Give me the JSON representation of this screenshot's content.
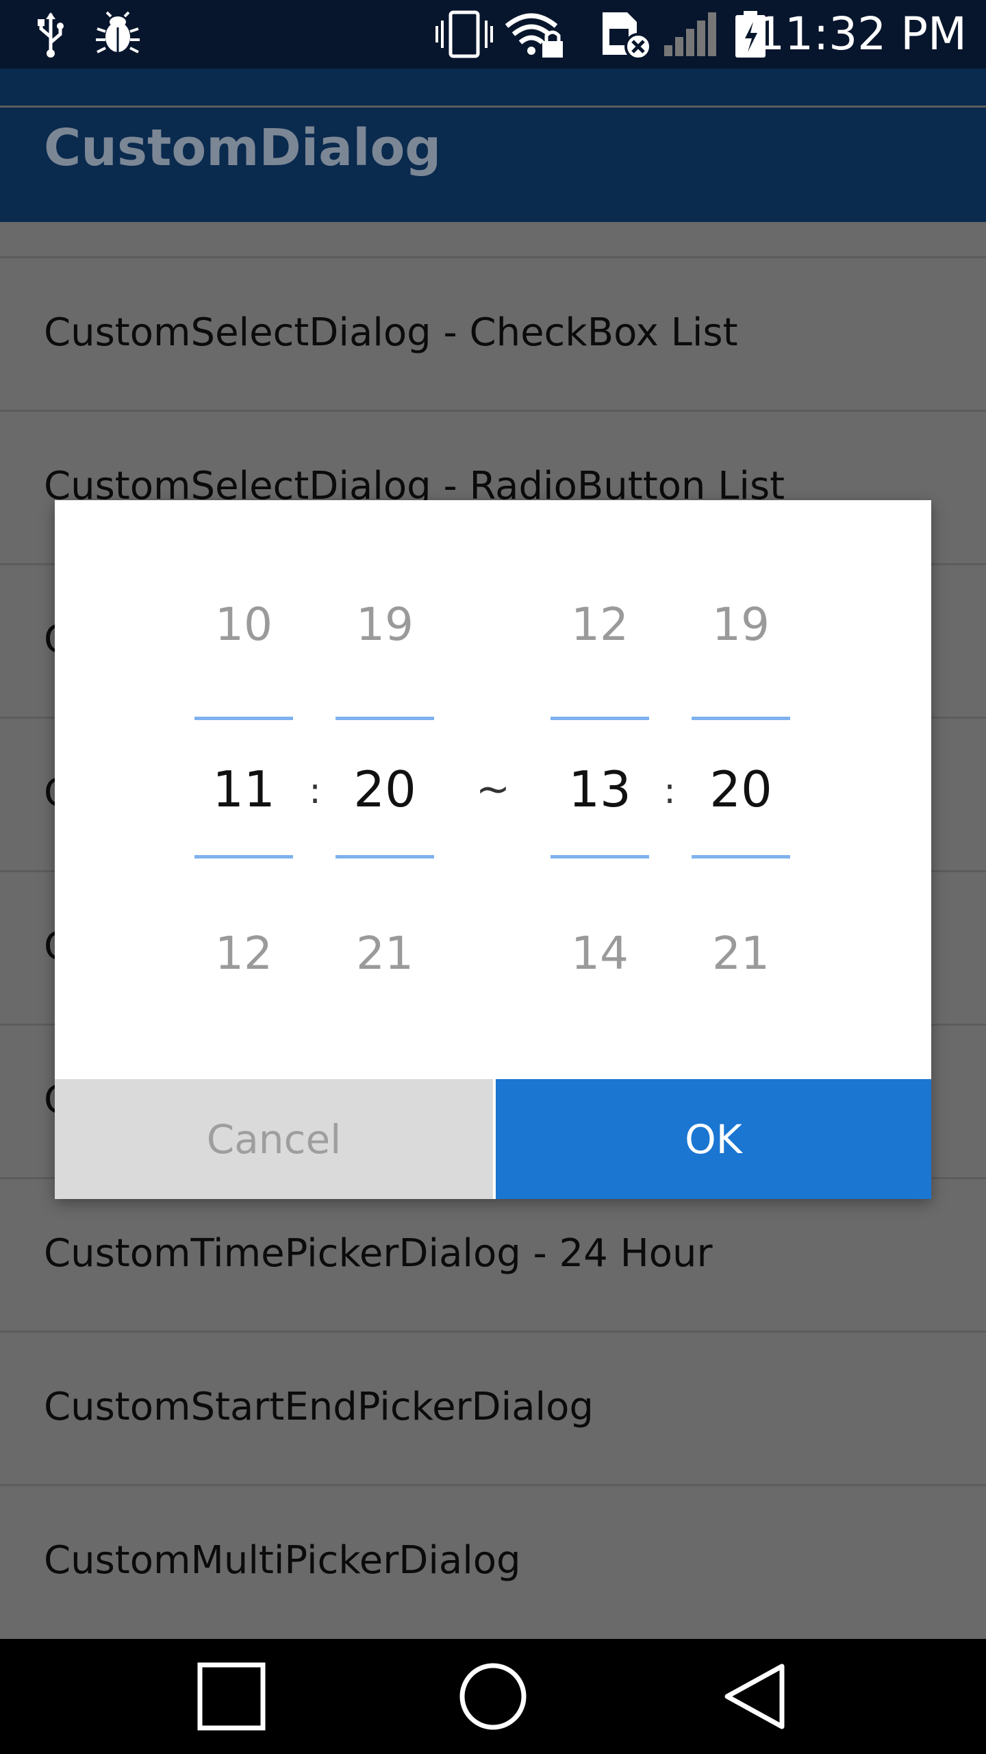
{
  "status_bar": {
    "time": "11:32 PM",
    "icons": [
      "usb-icon",
      "bug-icon",
      "vibrate-icon",
      "wifi-lock-icon",
      "sim-error-icon",
      "signal-icon",
      "battery-charging-icon"
    ]
  },
  "app_bar": {
    "title": "CustomDialog"
  },
  "list": {
    "items": [
      {
        "label": ""
      },
      {
        "label": "CustomSelectDialog - CheckBox List"
      },
      {
        "label": "CustomSelectDialog - RadioButton List"
      },
      {
        "label": "C"
      },
      {
        "label": "C"
      },
      {
        "label": "C"
      },
      {
        "label": "C"
      },
      {
        "label": "CustomTimePickerDialog - 24 Hour"
      },
      {
        "label": "CustomStartEndPickerDialog"
      },
      {
        "label": "CustomMultiPickerDialog"
      }
    ]
  },
  "dialog": {
    "start_hour": {
      "prev": "10",
      "current": "11",
      "next": "12"
    },
    "start_minute": {
      "prev": "19",
      "current": "20",
      "next": "21"
    },
    "end_hour": {
      "prev": "12",
      "current": "13",
      "next": "14"
    },
    "end_minute": {
      "prev": "19",
      "current": "20",
      "next": "21"
    },
    "time_separator": ":",
    "range_separator": "~",
    "cancel_label": "Cancel",
    "ok_label": "OK"
  },
  "nav_bar": {
    "buttons": [
      "recents-icon",
      "home-icon",
      "back-icon"
    ]
  },
  "colors": {
    "status_bar": "#07162c",
    "app_bar": "#0a2a4e",
    "accent_line": "#7eb2ef",
    "ok_button": "#1b76d2",
    "cancel_button": "#dadada"
  }
}
